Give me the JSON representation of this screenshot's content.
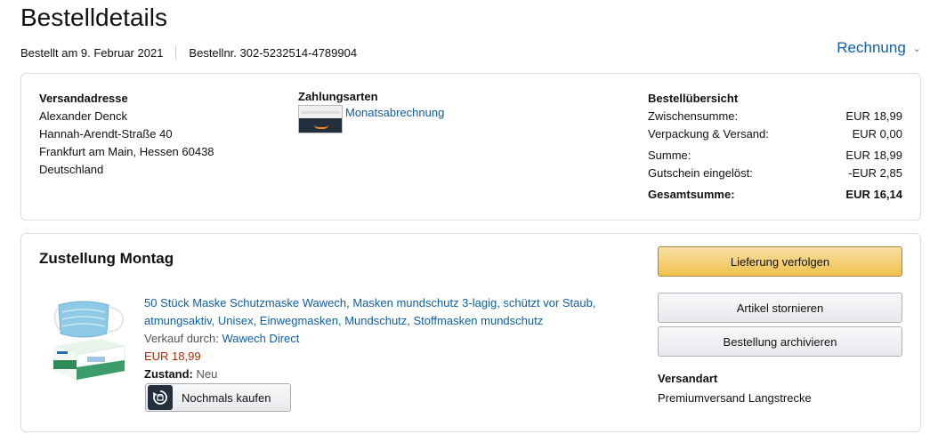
{
  "page": {
    "title": "Bestelldetails",
    "ordered_on": "Bestellt am 9. Februar 2021",
    "order_number": "Bestellnr. 302-5232514-4789904",
    "invoice_label": "Rechnung"
  },
  "shipping_address": {
    "heading": "Versandadresse",
    "lines": [
      "Alexander Denck",
      "Hannah-Arendt-Straße 40",
      "Frankfurt am Main, Hessen 60438",
      "Deutschland"
    ]
  },
  "payment": {
    "heading": "Zahlungsarten",
    "method": "Monatsabrechnung",
    "icon": "amazon-card-icon"
  },
  "summary": {
    "heading": "Bestellübersicht",
    "rows": [
      {
        "label": "Zwischensumme:",
        "value": "EUR 18,99"
      },
      {
        "label": "Verpackung & Versand:",
        "value": "EUR 0,00"
      },
      {
        "label": "Summe:",
        "value": "EUR 18,99"
      },
      {
        "label": "Gutschein eingelöst:",
        "value": "-EUR 2,85"
      },
      {
        "label": "Gesamtsumme:",
        "value": "EUR 16,14"
      }
    ]
  },
  "delivery": {
    "title": "Zustellung Montag",
    "item": {
      "title": "50 Stück Maske Schutzmaske Wawech, Masken mundschutz 3-lagig, schützt vor Staub, atmungsaktiv, Unisex, Einwegmasken, Mundschutz, Stoffmasken mundschutz",
      "seller_prefix": "Verkauf durch:",
      "seller": "Wawech Direct",
      "price": "EUR 18,99",
      "condition_label": "Zustand:",
      "condition": "Neu",
      "buy_again": "Nochmals kaufen"
    },
    "buttons": {
      "track": "Lieferung verfolgen",
      "cancel": "Artikel stornieren",
      "archive": "Bestellung archivieren"
    },
    "shipping_method": {
      "heading": "Versandart",
      "value": "Premiumversand Langstrecke"
    }
  },
  "colors": {
    "link": "#0f5ea8",
    "price": "#b12704",
    "primary_button": "#f0c14b"
  }
}
